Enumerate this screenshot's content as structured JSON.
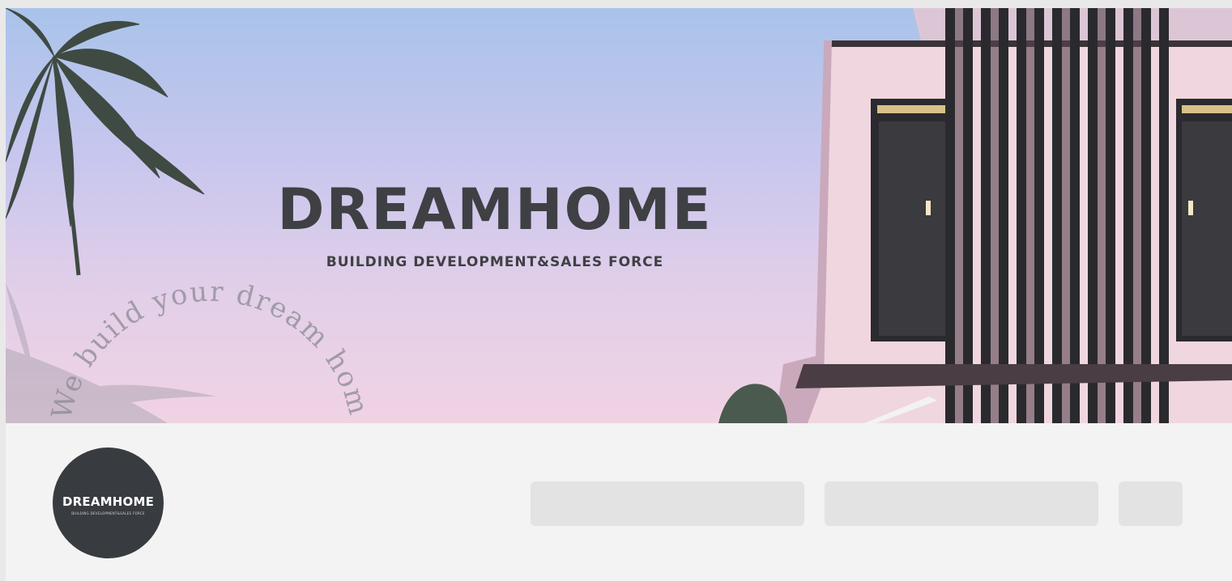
{
  "cover": {
    "title": "DREAMHOME",
    "subtitle": "BUILDING DEVELOPMENT&SALES FORCE",
    "tagline": "We build your dream home."
  },
  "profile": {
    "avatar_title": "DREAMHOME",
    "avatar_subtitle": "BUILDING DEVELOPMENT&SALES FORCE"
  },
  "colors": {
    "page_bg": "#e9e9e9",
    "profile_bg": "#f3f3f3",
    "placeholder": "#e3e3e3",
    "avatar_bg": "#383c40",
    "brand_text": "#3f4044"
  },
  "action_placeholders": [
    {
      "name": "action-placeholder-1"
    },
    {
      "name": "action-placeholder-2"
    },
    {
      "name": "action-placeholder-3"
    }
  ]
}
